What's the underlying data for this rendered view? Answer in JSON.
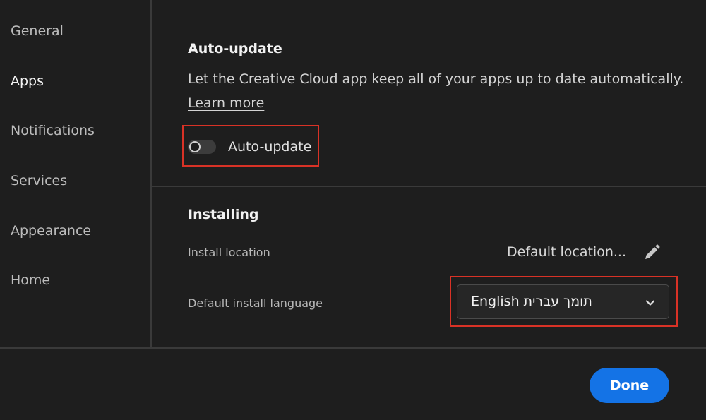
{
  "sidebar": {
    "items": [
      {
        "label": "General",
        "active": false
      },
      {
        "label": "Apps",
        "active": true
      },
      {
        "label": "Notifications",
        "active": false
      },
      {
        "label": "Services",
        "active": false
      },
      {
        "label": "Appearance",
        "active": false
      },
      {
        "label": "Home",
        "active": false
      }
    ]
  },
  "auto_update": {
    "heading": "Auto-update",
    "description": "Let the Creative Cloud app keep all of your apps up to date automatically.",
    "learn_more": "Learn more",
    "toggle_label": "Auto-update",
    "toggle_on": false
  },
  "installing": {
    "heading": "Installing",
    "location_label": "Install location",
    "location_value": "Default location...",
    "location_edit_icon": "pencil-icon",
    "language_label": "Default install language",
    "language_value": "English תומך עברית",
    "language_dropdown_icon": "chevron-down-icon"
  },
  "footer": {
    "done_label": "Done"
  },
  "colors": {
    "background": "#1e1e1e",
    "accent": "#1473e6",
    "highlight": "#d93226",
    "divider": "#3a3a3a"
  }
}
